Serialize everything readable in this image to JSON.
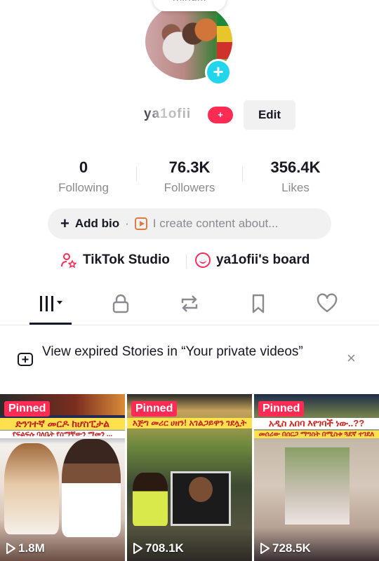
{
  "profile": {
    "note_bubble": "mind...",
    "username": "ya1ofii",
    "badge": "+",
    "edit_label": "Edit",
    "add_avatar_icon": "plus-icon"
  },
  "stats": [
    {
      "value": "0",
      "label": "Following"
    },
    {
      "value": "76.3K",
      "label": "Followers"
    },
    {
      "value": "356.4K",
      "label": "Likes"
    }
  ],
  "bio": {
    "add_label": "Add bio",
    "separator": "·",
    "hint": "I create content about..."
  },
  "links": {
    "studio_label": "TikTok Studio",
    "board_label": "ya1ofii's board"
  },
  "tabs": [
    "videos-grid-icon",
    "lock-icon",
    "repost-icon",
    "bookmark-icon",
    "heart-icon"
  ],
  "stories_banner": {
    "text": "View expired Stories in “Your private videos”",
    "close": "×"
  },
  "videos": [
    {
      "pinned": "Pinned",
      "views": "1.8M",
      "caption_top": "ድንገተኛ መርዶ ከሆስፒታል",
      "caption_sub": "የፍልፍሉ ባለቤት የስማቸውን ማመን ..."
    },
    {
      "pinned": "Pinned",
      "views": "708.1K",
      "caption_top": "እጅግ መሪር ሀዘን! አገልጋይዋን ገደሏት",
      "caption_sub": ""
    },
    {
      "pinned": "Pinned",
      "views": "728.5K",
      "caption_top": "አዲስ አበባ እየገባች ነው..??",
      "caption_sub": "መሰሪው በሰርጋ ማግስት በሚስቱ ጓደኛ ተገደለ"
    }
  ],
  "colors": {
    "accent": "#fe2c55",
    "cyan": "#20d5ec",
    "text": "#161823",
    "muted": "#8a8b91",
    "pill": "#f1f1f2"
  }
}
